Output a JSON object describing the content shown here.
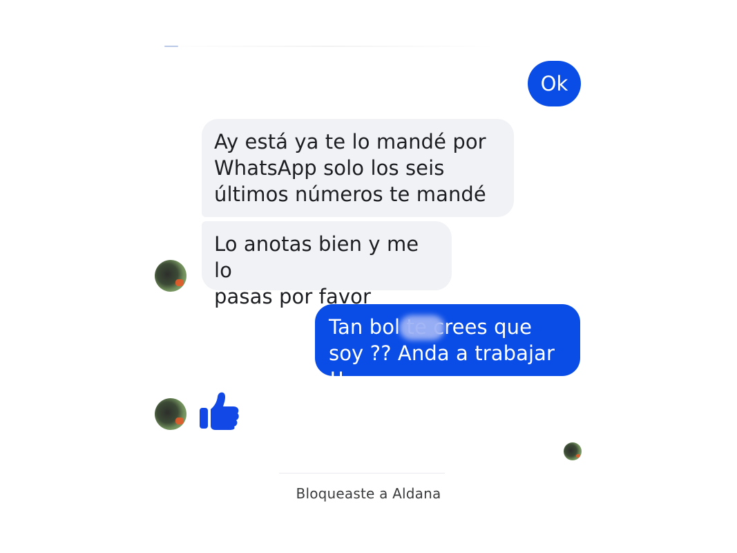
{
  "conversation": {
    "messages": [
      {
        "direction": "outgoing",
        "text": "Ok"
      },
      {
        "direction": "incoming",
        "text": "Ay está ya te lo mandé por\nWhatsApp solo los seis\núltimos números te mandé"
      },
      {
        "direction": "incoming",
        "text": "Lo anotas bien y me lo\npasas por favor"
      },
      {
        "direction": "outgoing",
        "text": "Tan bol          te crees que\nsoy ?? Anda a trabajar !!"
      }
    ],
    "reaction": {
      "icon": "thumbs-up-icon"
    },
    "status": "Bloqueaste a Aldana"
  },
  "colors": {
    "outgoing_bubble": "#0a4de6",
    "incoming_bubble": "#f1f2f6",
    "like_icon": "#1148e6"
  }
}
